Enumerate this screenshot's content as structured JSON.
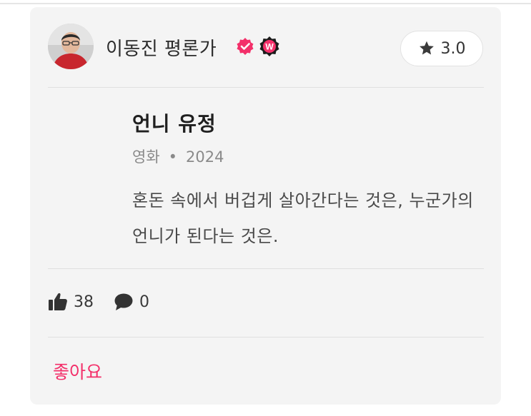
{
  "review": {
    "author_name": "이동진 평론가",
    "verified_badge": "check-badge-icon",
    "w_badge_label": "W",
    "rating": "3.0"
  },
  "content": {
    "title": "언니 유정",
    "category": "영화",
    "separator": "•",
    "year": "2024",
    "text": "혼돈 속에서 버겁게 살아간다는 것은, 누군가의 언니가 된다는 것은."
  },
  "stats": {
    "likes": "38",
    "comments": "0"
  },
  "actions": {
    "like_label": "좋아요"
  },
  "colors": {
    "accent": "#f3306a",
    "card_bg": "#f4f4f4"
  }
}
